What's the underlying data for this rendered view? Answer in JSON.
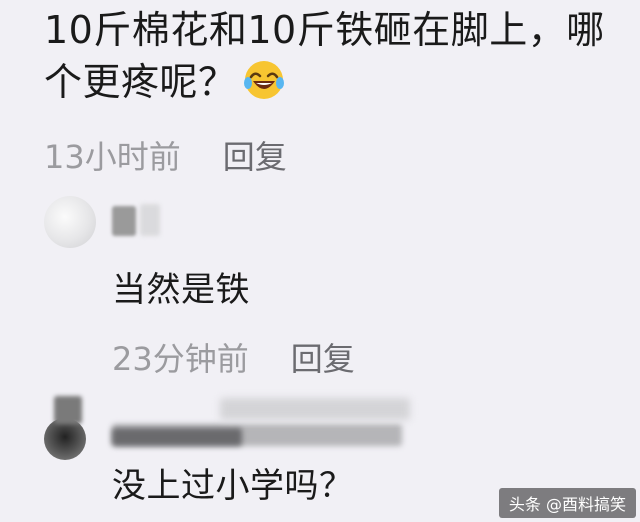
{
  "main_comment": {
    "line1": "10斤棉花和10斤铁砸在脚上，哪",
    "line2": "个更疼呢？",
    "emoji": "laughing-tears-emoji",
    "time": "13小时前",
    "reply_label": "回复"
  },
  "replies": [
    {
      "text": "当然是铁",
      "time": "23分钟前",
      "reply_label": "回复"
    },
    {
      "text": "没上过小学吗？"
    }
  ],
  "watermark": "头条 @酉料搞笑",
  "colors": {
    "background": "#f1f0f5",
    "text": "#1a1a1a",
    "meta": "#8a8a8e"
  }
}
